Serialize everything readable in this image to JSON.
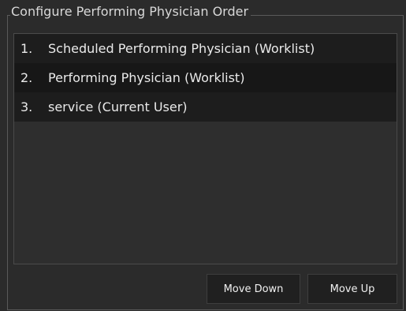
{
  "group": {
    "title": "Configure Performing Physician Order"
  },
  "list": {
    "items": [
      {
        "number": "1.",
        "label": "Scheduled Performing Physician (Worklist)"
      },
      {
        "number": "2.",
        "label": "Performing Physician (Worklist)"
      },
      {
        "number": "3.",
        "label": "service (Current User)"
      }
    ]
  },
  "buttons": {
    "move_down": "Move Down",
    "move_up": "Move Up"
  },
  "colors": {
    "panel_background": "#2b2b2b",
    "row_background_odd": "#1d1d1d",
    "row_background_even": "#171717",
    "text": "#eaeaea",
    "border": "#5a5a5a"
  }
}
